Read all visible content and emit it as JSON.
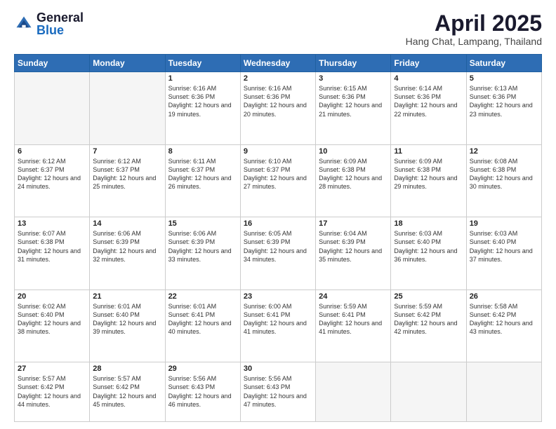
{
  "logo": {
    "general": "General",
    "blue": "Blue"
  },
  "header": {
    "month": "April 2025",
    "location": "Hang Chat, Lampang, Thailand"
  },
  "days_of_week": [
    "Sunday",
    "Monday",
    "Tuesday",
    "Wednesday",
    "Thursday",
    "Friday",
    "Saturday"
  ],
  "weeks": [
    [
      {
        "day": "",
        "info": ""
      },
      {
        "day": "",
        "info": ""
      },
      {
        "day": "1",
        "info": "Sunrise: 6:16 AM\nSunset: 6:36 PM\nDaylight: 12 hours and 19 minutes."
      },
      {
        "day": "2",
        "info": "Sunrise: 6:16 AM\nSunset: 6:36 PM\nDaylight: 12 hours and 20 minutes."
      },
      {
        "day": "3",
        "info": "Sunrise: 6:15 AM\nSunset: 6:36 PM\nDaylight: 12 hours and 21 minutes."
      },
      {
        "day": "4",
        "info": "Sunrise: 6:14 AM\nSunset: 6:36 PM\nDaylight: 12 hours and 22 minutes."
      },
      {
        "day": "5",
        "info": "Sunrise: 6:13 AM\nSunset: 6:36 PM\nDaylight: 12 hours and 23 minutes."
      }
    ],
    [
      {
        "day": "6",
        "info": "Sunrise: 6:12 AM\nSunset: 6:37 PM\nDaylight: 12 hours and 24 minutes."
      },
      {
        "day": "7",
        "info": "Sunrise: 6:12 AM\nSunset: 6:37 PM\nDaylight: 12 hours and 25 minutes."
      },
      {
        "day": "8",
        "info": "Sunrise: 6:11 AM\nSunset: 6:37 PM\nDaylight: 12 hours and 26 minutes."
      },
      {
        "day": "9",
        "info": "Sunrise: 6:10 AM\nSunset: 6:37 PM\nDaylight: 12 hours and 27 minutes."
      },
      {
        "day": "10",
        "info": "Sunrise: 6:09 AM\nSunset: 6:38 PM\nDaylight: 12 hours and 28 minutes."
      },
      {
        "day": "11",
        "info": "Sunrise: 6:09 AM\nSunset: 6:38 PM\nDaylight: 12 hours and 29 minutes."
      },
      {
        "day": "12",
        "info": "Sunrise: 6:08 AM\nSunset: 6:38 PM\nDaylight: 12 hours and 30 minutes."
      }
    ],
    [
      {
        "day": "13",
        "info": "Sunrise: 6:07 AM\nSunset: 6:38 PM\nDaylight: 12 hours and 31 minutes."
      },
      {
        "day": "14",
        "info": "Sunrise: 6:06 AM\nSunset: 6:39 PM\nDaylight: 12 hours and 32 minutes."
      },
      {
        "day": "15",
        "info": "Sunrise: 6:06 AM\nSunset: 6:39 PM\nDaylight: 12 hours and 33 minutes."
      },
      {
        "day": "16",
        "info": "Sunrise: 6:05 AM\nSunset: 6:39 PM\nDaylight: 12 hours and 34 minutes."
      },
      {
        "day": "17",
        "info": "Sunrise: 6:04 AM\nSunset: 6:39 PM\nDaylight: 12 hours and 35 minutes."
      },
      {
        "day": "18",
        "info": "Sunrise: 6:03 AM\nSunset: 6:40 PM\nDaylight: 12 hours and 36 minutes."
      },
      {
        "day": "19",
        "info": "Sunrise: 6:03 AM\nSunset: 6:40 PM\nDaylight: 12 hours and 37 minutes."
      }
    ],
    [
      {
        "day": "20",
        "info": "Sunrise: 6:02 AM\nSunset: 6:40 PM\nDaylight: 12 hours and 38 minutes."
      },
      {
        "day": "21",
        "info": "Sunrise: 6:01 AM\nSunset: 6:40 PM\nDaylight: 12 hours and 39 minutes."
      },
      {
        "day": "22",
        "info": "Sunrise: 6:01 AM\nSunset: 6:41 PM\nDaylight: 12 hours and 40 minutes."
      },
      {
        "day": "23",
        "info": "Sunrise: 6:00 AM\nSunset: 6:41 PM\nDaylight: 12 hours and 41 minutes."
      },
      {
        "day": "24",
        "info": "Sunrise: 5:59 AM\nSunset: 6:41 PM\nDaylight: 12 hours and 41 minutes."
      },
      {
        "day": "25",
        "info": "Sunrise: 5:59 AM\nSunset: 6:42 PM\nDaylight: 12 hours and 42 minutes."
      },
      {
        "day": "26",
        "info": "Sunrise: 5:58 AM\nSunset: 6:42 PM\nDaylight: 12 hours and 43 minutes."
      }
    ],
    [
      {
        "day": "27",
        "info": "Sunrise: 5:57 AM\nSunset: 6:42 PM\nDaylight: 12 hours and 44 minutes."
      },
      {
        "day": "28",
        "info": "Sunrise: 5:57 AM\nSunset: 6:42 PM\nDaylight: 12 hours and 45 minutes."
      },
      {
        "day": "29",
        "info": "Sunrise: 5:56 AM\nSunset: 6:43 PM\nDaylight: 12 hours and 46 minutes."
      },
      {
        "day": "30",
        "info": "Sunrise: 5:56 AM\nSunset: 6:43 PM\nDaylight: 12 hours and 47 minutes."
      },
      {
        "day": "",
        "info": ""
      },
      {
        "day": "",
        "info": ""
      },
      {
        "day": "",
        "info": ""
      }
    ]
  ]
}
